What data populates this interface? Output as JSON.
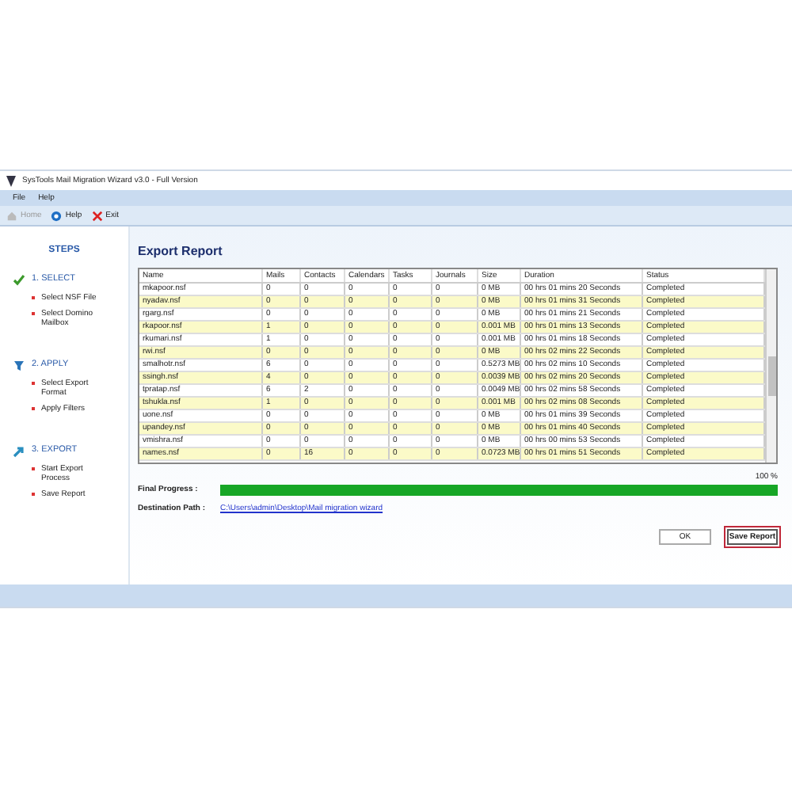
{
  "window": {
    "title": "SysTools Mail Migration Wizard v3.0 - Full Version"
  },
  "menu": [
    "File",
    "Help"
  ],
  "toolbar": [
    {
      "label": "Home",
      "disabled": true
    },
    {
      "label": "Help",
      "disabled": false
    },
    {
      "label": "Exit",
      "disabled": false
    }
  ],
  "sidebar": {
    "heading": "STEPS",
    "steps": [
      {
        "label": "1. SELECT",
        "items": [
          "Select NSF File",
          "Select Domino Mailbox"
        ]
      },
      {
        "label": "2. APPLY",
        "items": [
          "Select Export Format",
          "Apply Filters"
        ]
      },
      {
        "label": "3. EXPORT",
        "items": [
          "Start Export Process",
          "Save Report"
        ]
      }
    ]
  },
  "report": {
    "title": "Export Report",
    "columns": [
      "Name",
      "Mails",
      "Contacts",
      "Calendars",
      "Tasks",
      "Journals",
      "Size",
      "Duration",
      "Status"
    ],
    "rows": [
      [
        "mkapoor.nsf",
        "0",
        "0",
        "0",
        "0",
        "0",
        "0 MB",
        "00 hrs 01 mins 20 Seconds",
        "Completed"
      ],
      [
        "nyadav.nsf",
        "0",
        "0",
        "0",
        "0",
        "0",
        "0 MB",
        "00 hrs 01 mins 31 Seconds",
        "Completed"
      ],
      [
        "rgarg.nsf",
        "0",
        "0",
        "0",
        "0",
        "0",
        "0 MB",
        "00 hrs 01 mins 21 Seconds",
        "Completed"
      ],
      [
        "rkapoor.nsf",
        "1",
        "0",
        "0",
        "0",
        "0",
        "0.001 MB",
        "00 hrs 01 mins 13 Seconds",
        "Completed"
      ],
      [
        "rkumari.nsf",
        "1",
        "0",
        "0",
        "0",
        "0",
        "0.001 MB",
        "00 hrs 01 mins 18 Seconds",
        "Completed"
      ],
      [
        "rwi.nsf",
        "0",
        "0",
        "0",
        "0",
        "0",
        "0 MB",
        "00 hrs 02 mins 22 Seconds",
        "Completed"
      ],
      [
        "smalhotr.nsf",
        "6",
        "0",
        "0",
        "0",
        "0",
        "0.5273 MB",
        "00 hrs 02 mins 10 Seconds",
        "Completed"
      ],
      [
        "ssingh.nsf",
        "4",
        "0",
        "0",
        "0",
        "0",
        "0.0039 MB",
        "00 hrs 02 mins 20 Seconds",
        "Completed"
      ],
      [
        "tpratap.nsf",
        "6",
        "2",
        "0",
        "0",
        "0",
        "0.0049 MB",
        "00 hrs 02 mins 58 Seconds",
        "Completed"
      ],
      [
        "tshukla.nsf",
        "1",
        "0",
        "0",
        "0",
        "0",
        "0.001 MB",
        "00 hrs 02 mins 08 Seconds",
        "Completed"
      ],
      [
        "uone.nsf",
        "0",
        "0",
        "0",
        "0",
        "0",
        "0 MB",
        "00 hrs 01 mins 39 Seconds",
        "Completed"
      ],
      [
        "upandey.nsf",
        "0",
        "0",
        "0",
        "0",
        "0",
        "0 MB",
        "00 hrs 01 mins 40 Seconds",
        "Completed"
      ],
      [
        "vmishra.nsf",
        "0",
        "0",
        "0",
        "0",
        "0",
        "0 MB",
        "00 hrs 00 mins 53 Seconds",
        "Completed"
      ],
      [
        "names.nsf",
        "0",
        "16",
        "0",
        "0",
        "0",
        "0.0723 MB",
        "00 hrs 01 mins 51 Seconds",
        "Completed"
      ]
    ]
  },
  "progress": {
    "label": "Final Progress :",
    "level": 1,
    "reading": "100 %"
  },
  "destination": {
    "label": "Destination Path :",
    "path": "C:\\Users\\admin\\Desktop\\Mail migration wizard"
  },
  "buttons": [
    {
      "label": "OK",
      "focused": false
    },
    {
      "label": "Save Report",
      "focused": true
    }
  ]
}
